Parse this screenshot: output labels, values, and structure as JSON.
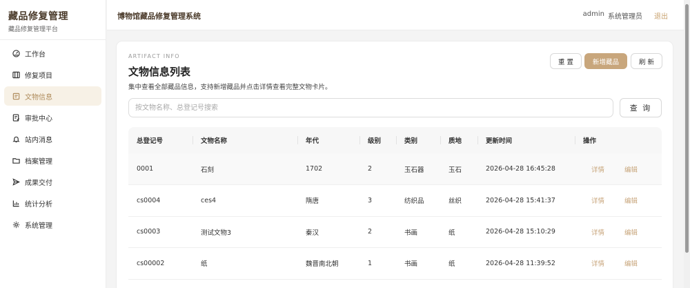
{
  "sidebar": {
    "brand_title": "藏品修复管理",
    "brand_subtitle": "藏品修复管理平台",
    "items": [
      {
        "label": "工作台",
        "icon": "dashboard-icon",
        "active": false
      },
      {
        "label": "修复项目",
        "icon": "project-icon",
        "active": false
      },
      {
        "label": "文物信息",
        "icon": "artifact-icon",
        "active": true
      },
      {
        "label": "审批中心",
        "icon": "approval-icon",
        "active": false
      },
      {
        "label": "站内消息",
        "icon": "bell-icon",
        "active": false
      },
      {
        "label": "档案管理",
        "icon": "folder-icon",
        "active": false
      },
      {
        "label": "成果交付",
        "icon": "send-icon",
        "active": false
      },
      {
        "label": "统计分析",
        "icon": "chart-icon",
        "active": false
      },
      {
        "label": "系统管理",
        "icon": "gear-icon",
        "active": false
      }
    ]
  },
  "header": {
    "system_title": "博物馆藏品修复管理系统",
    "username": "admin",
    "role": "系统管理员",
    "logout_label": "退出"
  },
  "main": {
    "eyebrow": "ARTIFACT INFO",
    "title": "文物信息列表",
    "description": "集中查看全部藏品信息，支持新增藏品并点击详情查看完整文物卡片。",
    "buttons": {
      "reset": "重 置",
      "add": "新增藏品",
      "refresh": "刷 新"
    },
    "search": {
      "placeholder": "按文物名称、总登记号搜索",
      "value": "",
      "button": "查 询"
    },
    "table": {
      "columns": [
        "总登记号",
        "文物名称",
        "年代",
        "级别",
        "类别",
        "质地",
        "更新时间",
        "操作"
      ],
      "rows": [
        {
          "reg_no": "0001",
          "name": "石刻",
          "era": "1702",
          "level": "2",
          "category": "玉石器",
          "material": "玉石",
          "updated": "2026-04-28 16:45:28"
        },
        {
          "reg_no": "cs0004",
          "name": "ces4",
          "era": "隋唐",
          "level": "3",
          "category": "纺织品",
          "material": "丝织",
          "updated": "2026-04-28 15:41:37"
        },
        {
          "reg_no": "cs0003",
          "name": "测试文物3",
          "era": "秦汉",
          "level": "2",
          "category": "书画",
          "material": "纸",
          "updated": "2026-04-28 15:10:29"
        },
        {
          "reg_no": "cs00002",
          "name": "纸",
          "era": "魏晋南北朝",
          "level": "1",
          "category": "书画",
          "material": "纸",
          "updated": "2026-04-28 11:39:52"
        }
      ],
      "row_actions": {
        "detail": "详情",
        "edit": "编辑"
      }
    }
  },
  "colors": {
    "accent": "#c8a67c",
    "brand_text": "#4a3a2a",
    "active_bg": "#f7f1e6"
  }
}
